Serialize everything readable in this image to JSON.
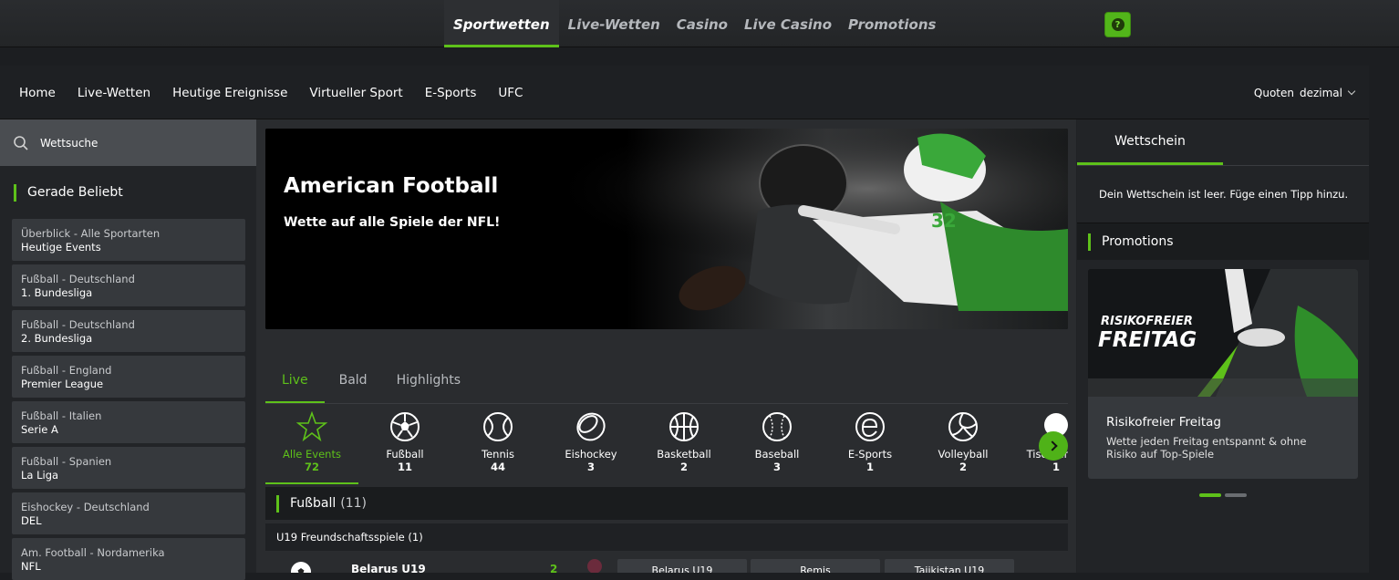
{
  "topnav": {
    "tabs": [
      "Sportwetten",
      "Live-Wetten",
      "Casino",
      "Live Casino",
      "Promotions"
    ],
    "help_label": "?"
  },
  "subnav": {
    "links": [
      "Home",
      "Live-Wetten",
      "Heutige Ereignisse",
      "Virtueller Sport",
      "E-Sports",
      "UFC"
    ],
    "quoten_label": "Quoten",
    "quoten_value": "dezimal"
  },
  "sidebar": {
    "search_placeholder": "Wettsuche",
    "heading": "Gerade Beliebt",
    "items": [
      {
        "l1": "Überblick - Alle Sportarten",
        "l2": "Heutige Events"
      },
      {
        "l1": "Fußball - Deutschland",
        "l2": "1. Bundesliga"
      },
      {
        "l1": "Fußball - Deutschland",
        "l2": "2. Bundesliga"
      },
      {
        "l1": "Fußball - England",
        "l2": "Premier League"
      },
      {
        "l1": "Fußball - Italien",
        "l2": "Serie A"
      },
      {
        "l1": "Fußball - Spanien",
        "l2": "La Liga"
      },
      {
        "l1": "Eishockey - Deutschland",
        "l2": "DEL"
      },
      {
        "l1": "Am. Football - Nordamerika",
        "l2": "NFL"
      }
    ]
  },
  "banner": {
    "title": "American Football",
    "subtitle": "Wette auf alle Spiele der NFL!"
  },
  "tabs": [
    "Live",
    "Bald",
    "Highlights"
  ],
  "sports": [
    {
      "name": "Alle Events",
      "count": "72",
      "icon": "star-icon"
    },
    {
      "name": "Fußball",
      "count": "11",
      "icon": "soccer-ball-icon"
    },
    {
      "name": "Tennis",
      "count": "44",
      "icon": "tennis-ball-icon"
    },
    {
      "name": "Eishockey",
      "count": "3",
      "icon": "hockey-puck-icon"
    },
    {
      "name": "Basketball",
      "count": "2",
      "icon": "basketball-icon"
    },
    {
      "name": "Baseball",
      "count": "3",
      "icon": "baseball-icon"
    },
    {
      "name": "E-Sports",
      "count": "1",
      "icon": "esports-icon"
    },
    {
      "name": "Volleyball",
      "count": "2",
      "icon": "volleyball-icon"
    },
    {
      "name": "Tischtennis",
      "count": "1",
      "icon": "table-tennis-icon"
    }
  ],
  "football_section": {
    "title": "Fußball",
    "count": "(11)"
  },
  "league": {
    "name": "U19 Freundschaftsspiele (1)"
  },
  "match": {
    "team": "Belarus U19",
    "score": "2",
    "odds": [
      "Belarus U19",
      "Remis",
      "Tajikistan U19"
    ]
  },
  "betslip": {
    "tab": "Wettschein",
    "empty_text": "Dein Wettschein ist leer. Füge einen Tipp hinzu."
  },
  "promotions": {
    "heading": "Promotions",
    "banner_line1": "RISIKOFREIER",
    "banner_line2": "FREITAG",
    "title": "Risikofreier Freitag",
    "description": "Wette jeden Freitag entspannt & ohne Risiko auf Top-Spiele"
  },
  "colors": {
    "accent": "#5ec11a",
    "background": "#202225"
  }
}
